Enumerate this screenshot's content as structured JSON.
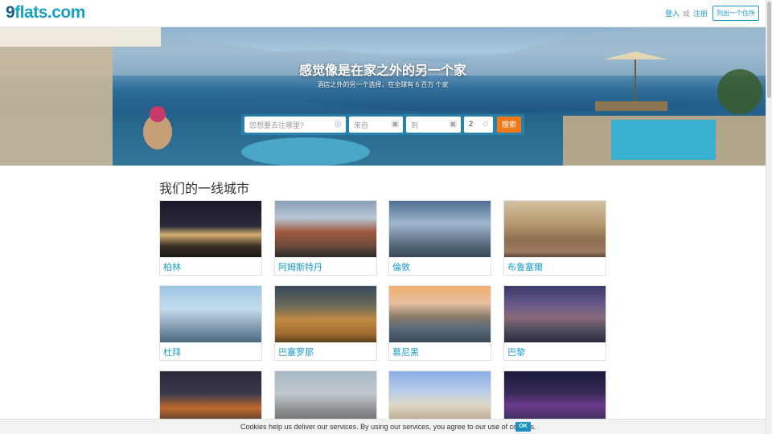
{
  "header": {
    "logo_num": "9",
    "logo_rest": "flats.com",
    "login_label": "登入",
    "or_label": "或",
    "register_label": "注册",
    "list_place_label": "列出一个住所"
  },
  "hero": {
    "title": "感觉像是在家之外的另一个家",
    "subtitle": "酒店之外的另一个选择，在全球有 6 百万 个家",
    "search": {
      "where_placeholder": "您想要去往哪里?",
      "from_placeholder": "来自",
      "to_placeholder": "到",
      "guests_value": "2",
      "search_button": "搜索",
      "globe_icon": "globe-icon",
      "calendar_icon": "calendar-icon",
      "guests_icon": "smiley-icon"
    }
  },
  "cities_section": {
    "title": "我们的一线城市",
    "cities": [
      {
        "name": "柏林"
      },
      {
        "name": "阿姆斯特丹"
      },
      {
        "name": "倫敦"
      },
      {
        "name": "布鲁塞爾"
      },
      {
        "name": "杜拜"
      },
      {
        "name": "巴塞罗那"
      },
      {
        "name": "慕尼黑"
      },
      {
        "name": "巴黎"
      }
    ]
  },
  "cookie_bar": {
    "text": "Cookies help us deliver our services. By using our services, you agree to our use of cookies.",
    "ok_label": "OK"
  },
  "colors": {
    "brand_blue": "#1a9bc8",
    "search_orange": "#f07a1a"
  }
}
